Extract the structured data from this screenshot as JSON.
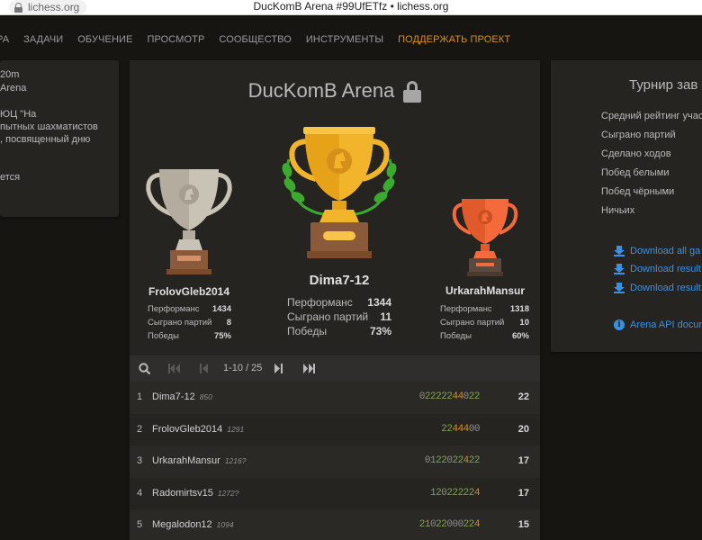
{
  "browser": {
    "url": "lichess.org",
    "window_title": "DucKomB Arena #99UfETfz • lichess.org"
  },
  "nav": {
    "items": [
      "РА",
      "ЗАДАЧИ",
      "ОБУЧЕНИЕ",
      "ПРОСМОТР",
      "СООБЩЕСТВО",
      "ИНСТРУМЕНТЫ"
    ],
    "support": "ПОДДЕРЖАТЬ ПРОЕКТ"
  },
  "side_left": {
    "lines": [
      "20m",
      "Arena",
      "",
      "ЮЦ \"На",
      "пытных шахматистов",
      ", посвященный дню",
      "",
      "ется"
    ]
  },
  "tournament": {
    "title": "DucKomB Arena"
  },
  "podium": {
    "first": {
      "name": "Dima7-12",
      "stats": [
        {
          "label": "Перформанс",
          "value": "1344"
        },
        {
          "label": "Сыграно партий",
          "value": "11"
        },
        {
          "label": "Победы",
          "value": "73%"
        }
      ]
    },
    "second": {
      "name": "FrolovGleb2014",
      "stats": [
        {
          "label": "Перформанс",
          "value": "1434"
        },
        {
          "label": "Сыграно партий",
          "value": "8"
        },
        {
          "label": "Победы",
          "value": "75%"
        }
      ]
    },
    "third": {
      "name": "UrkarahMansur",
      "stats": [
        {
          "label": "Перформанс",
          "value": "1318"
        },
        {
          "label": "Сыграно партий",
          "value": "10"
        },
        {
          "label": "Победы",
          "value": "60%"
        }
      ]
    }
  },
  "pager": {
    "count": "1-10 / 25"
  },
  "standings": [
    {
      "rank": "1",
      "name": "Dima7-12",
      "rating": "850",
      "sheet": "0222224402 2",
      "total": "22"
    },
    {
      "rank": "2",
      "name": "FrolovGleb2014",
      "rating": "1291",
      "sheet": "22444 00",
      "total": "20"
    },
    {
      "rank": "3",
      "name": "UrkarahMansur",
      "rating": "1216?",
      "sheet": "01220224 22",
      "total": "17"
    },
    {
      "rank": "4",
      "name": "Radomirtsv15",
      "rating": "1272?",
      "sheet": "1202222 24",
      "total": "17"
    },
    {
      "rank": "5",
      "name": "Megalodon12",
      "rating": "1094",
      "sheet": "2102200 0224",
      "total": "15"
    }
  ],
  "side_right": {
    "title": "Турнир зав",
    "stats": [
      "Средний рейтинг учас",
      "Сыграно партий",
      "Сделано ходов",
      "Побед белыми",
      "Побед чёрными",
      "Ничьих"
    ],
    "downloads": [
      "Download all ga",
      "Download result",
      "Download result"
    ],
    "api": "Arena API docum"
  },
  "colors": {
    "background": "#161512",
    "panel": "#262421",
    "accent_support": "#d59120",
    "link": "#3692e7",
    "gold": "#f2b42a",
    "silver": "#c9c3b6",
    "bronze": "#f46a3a",
    "laurel": "#3bab2e",
    "streak_green": "#7fa650",
    "streak_orange": "#d59120"
  }
}
